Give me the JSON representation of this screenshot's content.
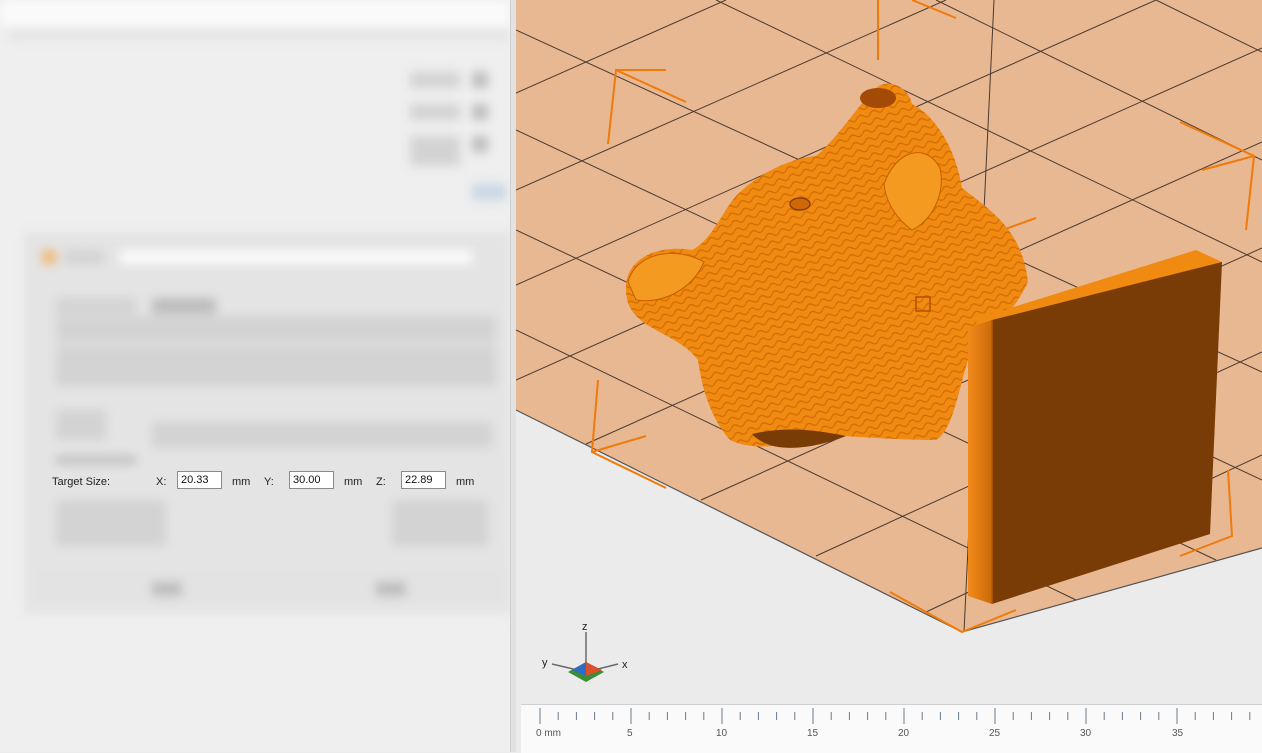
{
  "scale_dialog": {
    "target_size_label": "Target Size:",
    "x_label": "X:",
    "x_value": "20.33",
    "y_label": "Y:",
    "y_value": "30.00",
    "z_label": "Z:",
    "z_value": "22.89",
    "unit": "mm"
  },
  "axis_gizmo": {
    "x": "x",
    "y": "y",
    "z": "z"
  },
  "ruler": {
    "unit_label": "0 mm",
    "ticks": [
      "5",
      "10",
      "15",
      "20",
      "25",
      "30",
      "35"
    ]
  },
  "colors": {
    "model": "#f08a10",
    "bed": "#e8b892",
    "grid": "#4a3a30",
    "bounding_box": "#f07a0a",
    "support_plate_face": "#7a3c06"
  }
}
